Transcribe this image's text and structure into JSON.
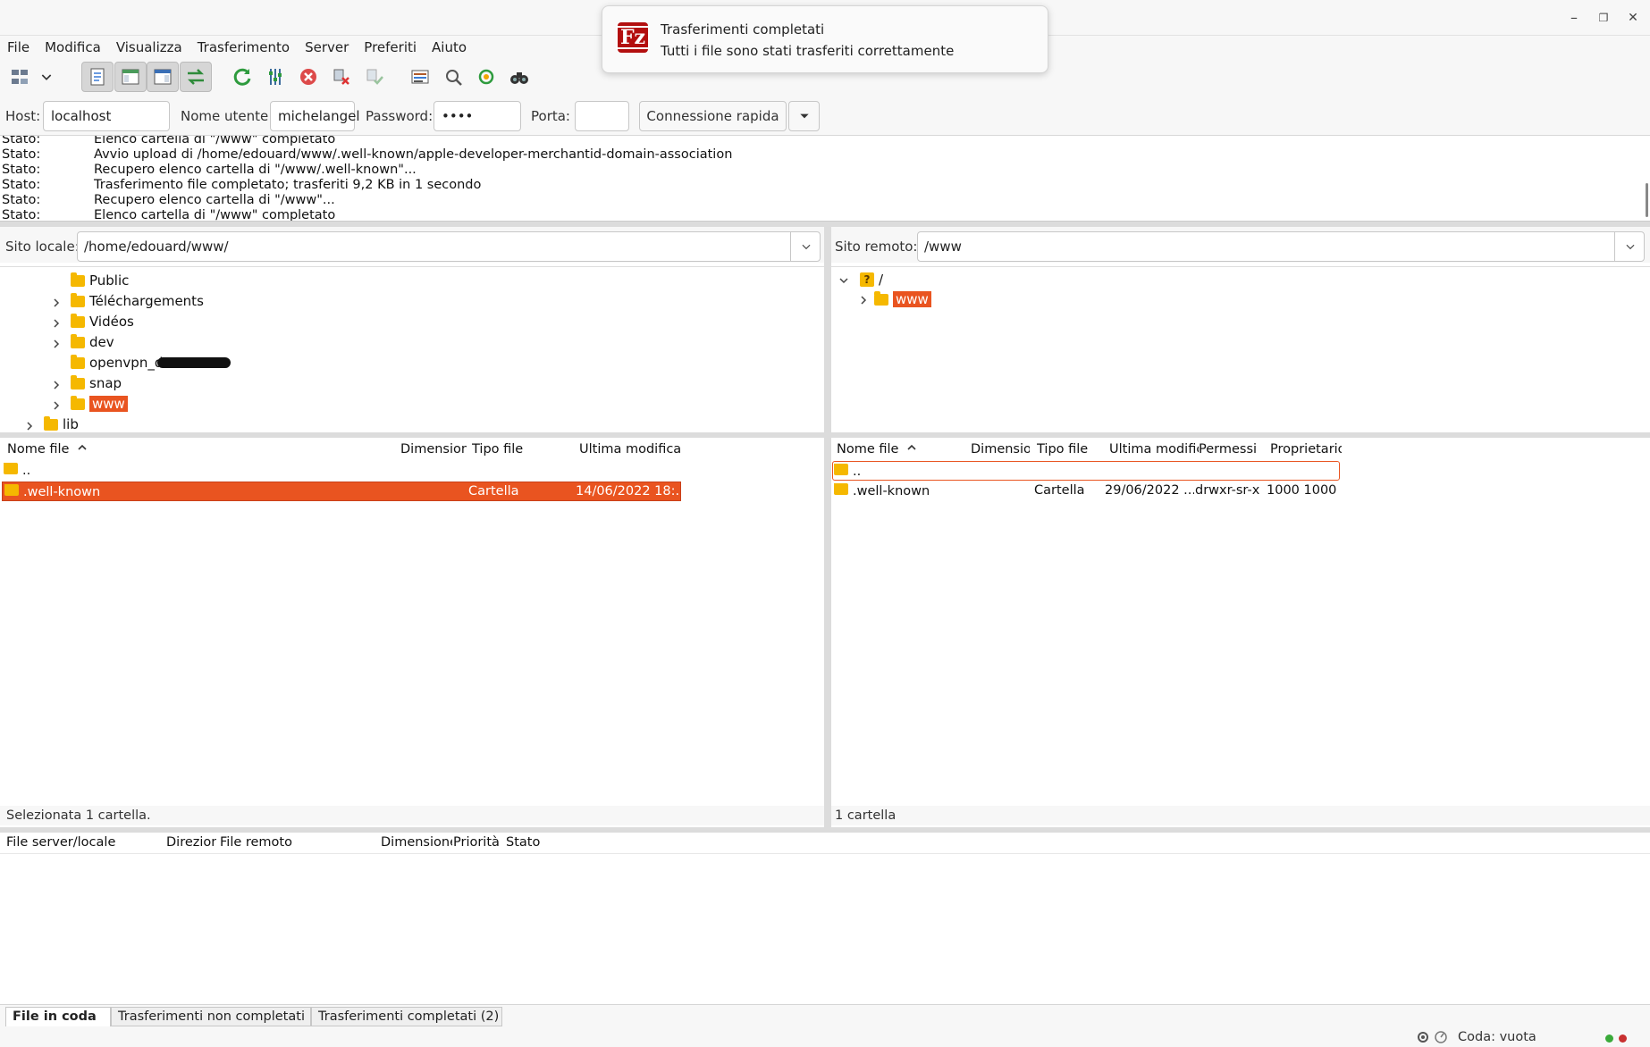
{
  "window": {
    "minimize_glyph": "–",
    "restore_glyph": "❐",
    "close_glyph": "✕"
  },
  "notification": {
    "title": "Trasferimenti completati",
    "body": "Tutti i file sono stati trasferiti correttamente",
    "logo_text": "Fz"
  },
  "menu": [
    "File",
    "Modifica",
    "Visualizza",
    "Trasferimento",
    "Server",
    "Preferiti",
    "Aiuto"
  ],
  "quickconnect": {
    "host_label": "Host:",
    "host_value": "localhost",
    "user_label": "Nome utente:",
    "user_value": "michelangel",
    "password_label": "Password:",
    "password_value": "••••",
    "port_label": "Porta:",
    "port_value": "",
    "connect_label": "Connessione rapida"
  },
  "log": [
    {
      "label": "Stato:",
      "text": "Elenco cartella di \"/www\" completato"
    },
    {
      "label": "Stato:",
      "text": "Avvio upload di /home/edouard/www/.well-known/apple-developer-merchantid-domain-association"
    },
    {
      "label": "Stato:",
      "text": "Recupero elenco cartella di \"/www/.well-known\"..."
    },
    {
      "label": "Stato:",
      "text": "Trasferimento file completato; trasferiti 9,2 KB in 1 secondo"
    },
    {
      "label": "Stato:",
      "text": "Recupero elenco cartella di \"/www\"..."
    },
    {
      "label": "Stato:",
      "text": "Elenco cartella di \"/www\" completato"
    }
  ],
  "local": {
    "site_label": "Sito locale:",
    "path": "/home/edouard/www/",
    "tree": [
      {
        "name": "Public",
        "expandable": false
      },
      {
        "name": "Téléchargements",
        "expandable": true
      },
      {
        "name": "Vidéos",
        "expandable": true
      },
      {
        "name": "dev",
        "expandable": true
      },
      {
        "name": "openvpn_d",
        "expandable": false
      },
      {
        "name": "snap",
        "expandable": true
      },
      {
        "name": "www",
        "expandable": true,
        "selected": true
      },
      {
        "name": "lib",
        "expandable": true
      }
    ],
    "columns": [
      "Nome file",
      "Dimensione",
      "Tipo file",
      "Ultima modifica"
    ],
    "rows": [
      {
        "name": "..",
        "size": "",
        "type": "",
        "modified": ""
      },
      {
        "name": ".well-known",
        "size": "",
        "type": "Cartella",
        "modified": "14/06/2022 18:..."
      }
    ],
    "status": "Selezionata 1 cartella."
  },
  "remote": {
    "site_label": "Sito remoto:",
    "path": "/www",
    "tree": [
      {
        "name": "/",
        "expandable": true,
        "unknown": true
      },
      {
        "name": "www",
        "expandable": true,
        "selected": true
      }
    ],
    "columns": [
      "Nome file",
      "Dimensione",
      "Tipo file",
      "Ultima modifica",
      "Permessi",
      "Proprietario"
    ],
    "rows": [
      {
        "name": "..",
        "size": "",
        "type": "",
        "modified": "",
        "perms": "",
        "owner": ""
      },
      {
        "name": ".well-known",
        "size": "",
        "type": "Cartella",
        "modified": "29/06/2022 ...",
        "perms": "drwxr-sr-x",
        "owner": "1000 1000"
      }
    ],
    "status": "1 cartella"
  },
  "queue": {
    "columns": [
      "File server/locale",
      "Direzione",
      "File remoto",
      "Dimensione",
      "Priorità",
      "Stato"
    ],
    "tabs": [
      "File in coda",
      "Trasferimenti non completati",
      "Trasferimenti completati (2)"
    ],
    "status": "Coda: vuota"
  },
  "colors": {
    "accent": "#e95420",
    "folder": "#f5b800",
    "logo": "#b30f0f"
  }
}
